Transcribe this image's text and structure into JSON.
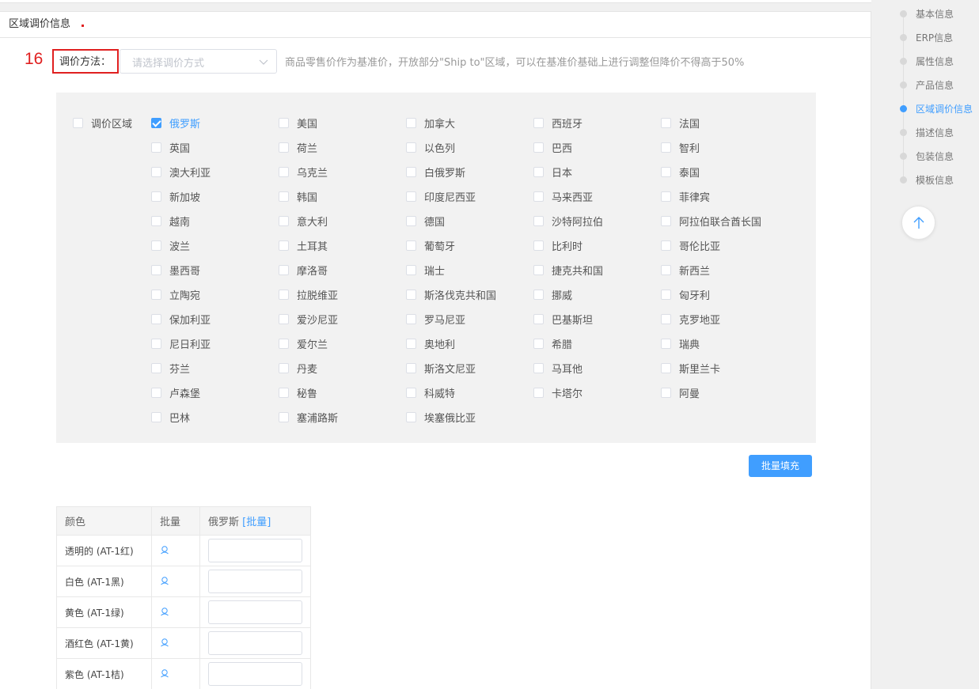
{
  "panel": {
    "title": "区域调价信息"
  },
  "step_number": "16",
  "method": {
    "label": "调价方法：",
    "placeholder": "请选择调价方式",
    "hint": "商品零售价作为基准价，开放部分\"Ship to\"区域，可以在基准价基础上进行调整但降价不得高于50%"
  },
  "region": {
    "all_label": "调价区域",
    "all_checked": false,
    "countries": [
      {
        "name": "俄罗斯",
        "checked": true
      },
      {
        "name": "美国",
        "checked": false
      },
      {
        "name": "加拿大",
        "checked": false
      },
      {
        "name": "西班牙",
        "checked": false
      },
      {
        "name": "法国",
        "checked": false
      },
      {
        "name": "英国",
        "checked": false
      },
      {
        "name": "荷兰",
        "checked": false
      },
      {
        "name": "以色列",
        "checked": false
      },
      {
        "name": "巴西",
        "checked": false
      },
      {
        "name": "智利",
        "checked": false
      },
      {
        "name": "澳大利亚",
        "checked": false
      },
      {
        "name": "乌克兰",
        "checked": false
      },
      {
        "name": "白俄罗斯",
        "checked": false
      },
      {
        "name": "日本",
        "checked": false
      },
      {
        "name": "泰国",
        "checked": false
      },
      {
        "name": "新加坡",
        "checked": false
      },
      {
        "name": "韩国",
        "checked": false
      },
      {
        "name": "印度尼西亚",
        "checked": false
      },
      {
        "name": "马来西亚",
        "checked": false
      },
      {
        "name": "菲律宾",
        "checked": false
      },
      {
        "name": "越南",
        "checked": false
      },
      {
        "name": "意大利",
        "checked": false
      },
      {
        "name": "德国",
        "checked": false
      },
      {
        "name": "沙特阿拉伯",
        "checked": false
      },
      {
        "name": "阿拉伯联合酋长国",
        "checked": false
      },
      {
        "name": "波兰",
        "checked": false
      },
      {
        "name": "土耳其",
        "checked": false
      },
      {
        "name": "葡萄牙",
        "checked": false
      },
      {
        "name": "比利时",
        "checked": false
      },
      {
        "name": "哥伦比亚",
        "checked": false
      },
      {
        "name": "墨西哥",
        "checked": false
      },
      {
        "name": "摩洛哥",
        "checked": false
      },
      {
        "name": "瑞士",
        "checked": false
      },
      {
        "name": "捷克共和国",
        "checked": false
      },
      {
        "name": "新西兰",
        "checked": false
      },
      {
        "name": "立陶宛",
        "checked": false
      },
      {
        "name": "拉脱维亚",
        "checked": false
      },
      {
        "name": "斯洛伐克共和国",
        "checked": false
      },
      {
        "name": "挪威",
        "checked": false
      },
      {
        "name": "匈牙利",
        "checked": false
      },
      {
        "name": "保加利亚",
        "checked": false
      },
      {
        "name": "爱沙尼亚",
        "checked": false
      },
      {
        "name": "罗马尼亚",
        "checked": false
      },
      {
        "name": "巴基斯坦",
        "checked": false
      },
      {
        "name": "克罗地亚",
        "checked": false
      },
      {
        "name": "尼日利亚",
        "checked": false
      },
      {
        "name": "爱尔兰",
        "checked": false
      },
      {
        "name": "奥地利",
        "checked": false
      },
      {
        "name": "希腊",
        "checked": false
      },
      {
        "name": "瑞典",
        "checked": false
      },
      {
        "name": "芬兰",
        "checked": false
      },
      {
        "name": "丹麦",
        "checked": false
      },
      {
        "name": "斯洛文尼亚",
        "checked": false
      },
      {
        "name": "马耳他",
        "checked": false
      },
      {
        "name": "斯里兰卡",
        "checked": false
      },
      {
        "name": "卢森堡",
        "checked": false
      },
      {
        "name": "秘鲁",
        "checked": false
      },
      {
        "name": "科威特",
        "checked": false
      },
      {
        "name": "卡塔尔",
        "checked": false
      },
      {
        "name": "阿曼",
        "checked": false
      },
      {
        "name": "巴林",
        "checked": false
      },
      {
        "name": "塞浦路斯",
        "checked": false
      },
      {
        "name": "埃塞俄比亚",
        "checked": false
      }
    ]
  },
  "batch_fill_button": "批量填充",
  "table": {
    "headers": {
      "color": "颜色",
      "batch": "批量",
      "russia": "俄罗斯",
      "russia_batch": "[批量]"
    },
    "rows": [
      {
        "color": "透明的 (AT-1红)",
        "value": ""
      },
      {
        "color": "白色 (AT-1黑)",
        "value": ""
      },
      {
        "color": "黄色 (AT-1绿)",
        "value": ""
      },
      {
        "color": "酒红色 (AT-1黄)",
        "value": ""
      },
      {
        "color": "紫色 (AT-1桔)",
        "value": ""
      }
    ]
  },
  "side_nav": {
    "items": [
      {
        "label": "基本信息",
        "active": false
      },
      {
        "label": "ERP信息",
        "active": false
      },
      {
        "label": "属性信息",
        "active": false
      },
      {
        "label": "产品信息",
        "active": false
      },
      {
        "label": "区域调价信息",
        "active": true
      },
      {
        "label": "描述信息",
        "active": false
      },
      {
        "label": "包装信息",
        "active": false
      },
      {
        "label": "模板信息",
        "active": false
      }
    ]
  },
  "colors": {
    "accent": "#409eff",
    "highlight": "#e02020"
  }
}
